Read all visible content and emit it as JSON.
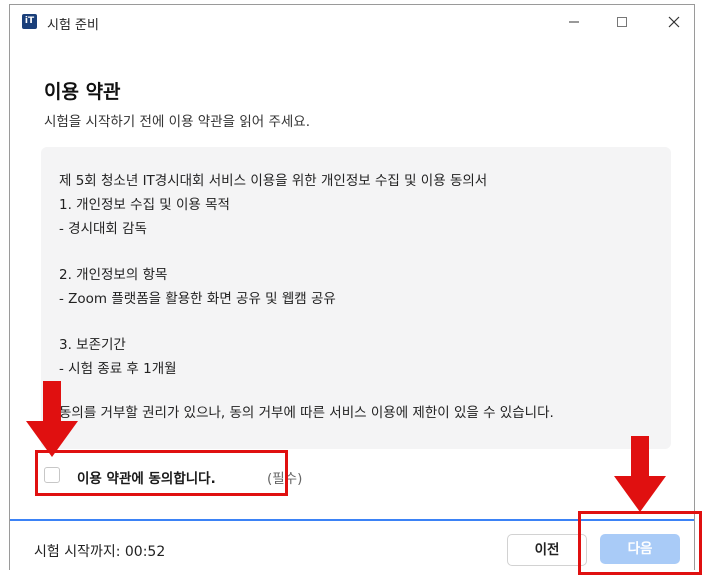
{
  "window": {
    "title": "시험 준비",
    "app_icon_text": "iT"
  },
  "page": {
    "heading": "이용 약관",
    "subtitle": "시험을 시작하기 전에 이용 약관을 읽어 주세요."
  },
  "terms": {
    "lines": [
      "제 5회 청소년 IT경시대회 서비스 이용을 위한 개인정보 수집 및 이용 동의서",
      "1. 개인정보 수집 및 이용 목적",
      "- 경시대회 감독",
      " 2. 개인정보의 항목",
      "- Zoom 플랫폼을 활용한 화면 공유 및 웹캠 공유",
      "3. 보존기간",
      "- 시험 종료 후 1개월",
      "동의를 거부할 권리가 있으나, 동의 거부에 따른 서비스 이용에 제한이 있을 수 있습니다."
    ]
  },
  "agreement": {
    "label": "이용 약관에 동의합니다.",
    "required": "(필수)",
    "checked": false
  },
  "footer": {
    "countdown": "시험 시작까지: 00:52",
    "prev_label": "이전",
    "next_label": "다음"
  },
  "annotations": {
    "highlight_color": "#e01010"
  },
  "colors": {
    "accent": "#3b82f6",
    "next_button_disabled": "#a9cbf7",
    "terms_background": "#f4f4f5"
  }
}
